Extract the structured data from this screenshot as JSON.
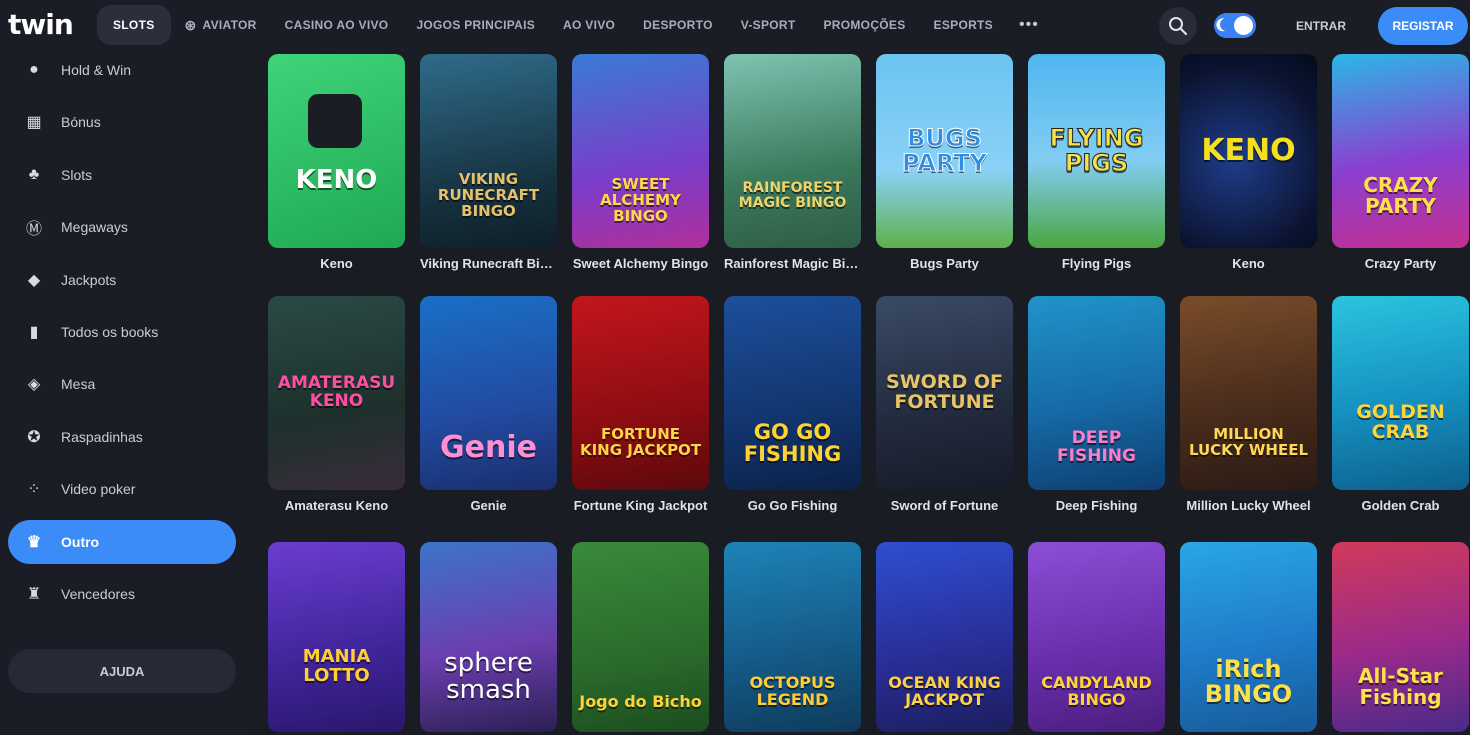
{
  "brand": {
    "logo": "twin",
    "accent": "#3b8cf7"
  },
  "nav": {
    "items": [
      {
        "label": "SLOTS",
        "active": true
      },
      {
        "label": "AVIATOR",
        "icon": "aviator-icon"
      },
      {
        "label": "CASINO AO VIVO"
      },
      {
        "label": "JOGOS PRINCIPAIS"
      },
      {
        "label": "AO VIVO"
      },
      {
        "label": "DESPORTO"
      },
      {
        "label": "V-SPORT"
      },
      {
        "label": "PROMOÇÕES"
      },
      {
        "label": "ESPORTS"
      }
    ],
    "more": "•••",
    "login": "ENTRAR",
    "register": "REGISTAR"
  },
  "sidebar": {
    "items": [
      {
        "label": "Hold & Win",
        "icon": "coin-icon"
      },
      {
        "label": "Bónus",
        "icon": "gift-icon"
      },
      {
        "label": "Slots",
        "icon": "cherries-icon"
      },
      {
        "label": "Megaways",
        "icon": "megaways-icon"
      },
      {
        "label": "Jackpots",
        "icon": "diamond-icon"
      },
      {
        "label": "Todos os books",
        "icon": "book-icon"
      },
      {
        "label": "Mesa",
        "icon": "table-icon"
      },
      {
        "label": "Raspadinhas",
        "icon": "scratch-card-icon"
      },
      {
        "label": "Video poker",
        "icon": "dice-icon"
      },
      {
        "label": "Outro",
        "icon": "crown-icon",
        "active": true
      },
      {
        "label": "Vencedores",
        "icon": "trophy-icon"
      }
    ],
    "help": "AJUDA"
  },
  "games": {
    "row1": [
      {
        "name": "Keno",
        "art": "KENO"
      },
      {
        "name": "Viking Runecraft Bingo",
        "art": "VIKING RUNECRAFT BINGO"
      },
      {
        "name": "Sweet Alchemy Bingo",
        "art": "SWEET ALCHEMY BINGO"
      },
      {
        "name": "Rainforest Magic Bingo",
        "art": "RAINFOREST MAGIC BINGO"
      },
      {
        "name": "Bugs Party",
        "art": "BUGS PARTY"
      },
      {
        "name": "Flying Pigs",
        "art": "FLYING PIGS"
      },
      {
        "name": "Keno",
        "art": "KENO"
      },
      {
        "name": "Crazy Party",
        "art": "CRAZY PARTY"
      }
    ],
    "row2": [
      {
        "name": "Amaterasu Keno",
        "art": "AMATERASU KENO"
      },
      {
        "name": "Genie",
        "art": "Genie"
      },
      {
        "name": "Fortune King Jackpot",
        "art": "FORTUNE KING JACKPOT"
      },
      {
        "name": "Go Go Fishing",
        "art": "GO GO FISHING"
      },
      {
        "name": "Sword of Fortune",
        "art": "SWORD OF FORTUNE"
      },
      {
        "name": "Deep Fishing",
        "art": "DEEP FISHING"
      },
      {
        "name": "Million Lucky Wheel",
        "art": "MILLION LUCKY WHEEL"
      },
      {
        "name": "Golden Crab",
        "art": "GOLDEN CRAB"
      }
    ],
    "row3": [
      {
        "art": "MANIA LOTTO"
      },
      {
        "art": "sphere smash"
      },
      {
        "art": "Jogo do Bicho"
      },
      {
        "art": "OCTOPUS LEGEND"
      },
      {
        "art": "OCEAN KING JACKPOT"
      },
      {
        "art": "CANDYLAND BINGO"
      },
      {
        "art": "iRich BINGO"
      },
      {
        "art": "All-Star Fishing"
      }
    ]
  }
}
